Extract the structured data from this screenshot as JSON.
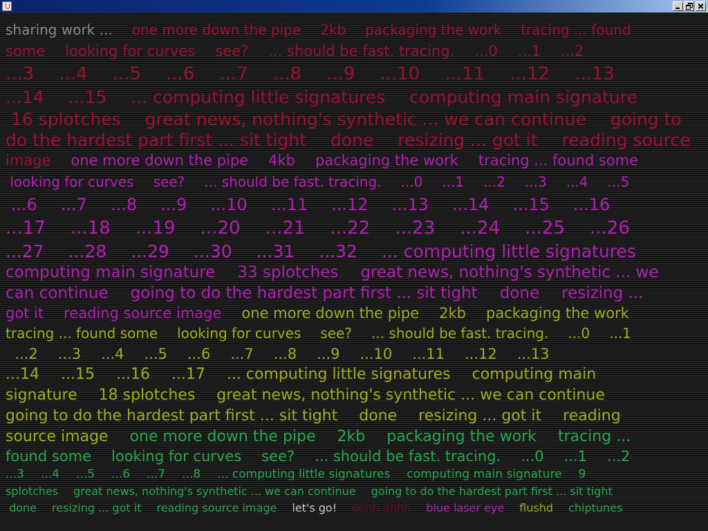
{
  "window": {
    "title": "",
    "buttons": {
      "minimize": "minimize",
      "maximize": "maximize",
      "close": "close"
    }
  },
  "colors": {
    "background": "#1c1c1c",
    "gray": "#8a8a8a",
    "red": "#9a1230",
    "magenta": "#b31fb5",
    "olive": "#a3ad21",
    "green": "#29a84e",
    "white": "#dddddd"
  },
  "lines": [
    {
      "size": 20,
      "h": 30,
      "segs": [
        {
          "t": "sharing work ...",
          "c": "#8a8a8a"
        },
        {
          "t": "one more down the pipe",
          "c": "#9a1230"
        },
        {
          "t": "2kb",
          "c": "#9a1230"
        },
        {
          "t": "packaging the work",
          "c": "#9a1230"
        },
        {
          "t": "tracing ... found",
          "c": "#9a1230"
        }
      ]
    },
    {
      "size": 21,
      "h": 32,
      "segs": [
        {
          "t": "some",
          "c": "#9a1230"
        },
        {
          "t": "looking for curves",
          "c": "#9a1230"
        },
        {
          "t": "see?",
          "c": "#9a1230"
        },
        {
          "t": "... should be fast. tracing.",
          "c": "#9a1230"
        },
        {
          "t": "...0",
          "c": "#9a1230"
        },
        {
          "t": "...1",
          "c": "#9a1230"
        },
        {
          "t": "...2",
          "c": "#9a1230"
        }
      ]
    },
    {
      "size": 26,
      "h": 34,
      "segs": [
        {
          "t": "...3",
          "c": "#9a1230"
        },
        {
          "t": "...4",
          "c": "#9a1230"
        },
        {
          "t": "...5",
          "c": "#9a1230"
        },
        {
          "t": "...6",
          "c": "#9a1230"
        },
        {
          "t": "...7",
          "c": "#9a1230"
        },
        {
          "t": "...8",
          "c": "#9a1230"
        },
        {
          "t": "...9",
          "c": "#9a1230"
        },
        {
          "t": "...10",
          "c": "#9a1230"
        },
        {
          "t": "...11",
          "c": "#9a1230"
        },
        {
          "t": "...12",
          "c": "#9a1230"
        },
        {
          "t": "...13",
          "c": "#9a1230"
        }
      ]
    },
    {
      "size": 25,
      "h": 33,
      "segs": [
        {
          "t": "...14",
          "c": "#9a1230"
        },
        {
          "t": "...15",
          "c": "#9a1230"
        },
        {
          "t": "... computing little signatures",
          "c": "#9a1230"
        },
        {
          "t": "computing main signature",
          "c": "#9a1230"
        }
      ]
    },
    {
      "size": 25,
      "h": 31,
      "segs": [
        {
          "t": " 16 splotches",
          "c": "#9a1230"
        },
        {
          "t": "great news, nothing's synthetic ... we can continue",
          "c": "#9a1230"
        },
        {
          "t": "going to",
          "c": "#9a1230"
        }
      ]
    },
    {
      "size": 25,
      "h": 30,
      "segs": [
        {
          "t": "do the hardest part first ... sit tight",
          "c": "#9a1230"
        },
        {
          "t": "done",
          "c": "#9a1230"
        },
        {
          "t": "resizing ... got it",
          "c": "#9a1230"
        },
        {
          "t": "reading source",
          "c": "#9a1230"
        }
      ]
    },
    {
      "size": 21,
      "h": 29,
      "segs": [
        {
          "t": "image",
          "c": "#9a1230"
        },
        {
          "t": "one more down the pipe",
          "c": "#b31fb5"
        },
        {
          "t": "4kb",
          "c": "#b31fb5"
        },
        {
          "t": "packaging the work",
          "c": "#b31fb5"
        },
        {
          "t": "tracing ... found some",
          "c": "#b31fb5"
        }
      ]
    },
    {
      "size": 20,
      "h": 32,
      "segs": [
        {
          "t": " looking for curves",
          "c": "#b31fb5"
        },
        {
          "t": "see?",
          "c": "#b31fb5"
        },
        {
          "t": "... should be fast. tracing.",
          "c": "#b31fb5"
        },
        {
          "t": "...0",
          "c": "#b31fb5"
        },
        {
          "t": "...1",
          "c": "#b31fb5"
        },
        {
          "t": "...2",
          "c": "#b31fb5"
        },
        {
          "t": "...3",
          "c": "#b31fb5"
        },
        {
          "t": "...4",
          "c": "#b31fb5"
        },
        {
          "t": "...5",
          "c": "#b31fb5"
        }
      ]
    },
    {
      "size": 24,
      "h": 34,
      "segs": [
        {
          "t": " ...6",
          "c": "#b31fb5"
        },
        {
          "t": "...7",
          "c": "#b31fb5"
        },
        {
          "t": "...8",
          "c": "#b31fb5"
        },
        {
          "t": "...9",
          "c": "#b31fb5"
        },
        {
          "t": "...10",
          "c": "#b31fb5"
        },
        {
          "t": "...11",
          "c": "#b31fb5"
        },
        {
          "t": "...12",
          "c": "#b31fb5"
        },
        {
          "t": "...13",
          "c": "#b31fb5"
        },
        {
          "t": "...14",
          "c": "#b31fb5"
        },
        {
          "t": "...15",
          "c": "#b31fb5"
        },
        {
          "t": "...16",
          "c": "#b31fb5"
        }
      ]
    },
    {
      "size": 26,
      "h": 35,
      "segs": [
        {
          "t": "...17",
          "c": "#b31fb5"
        },
        {
          "t": "...18",
          "c": "#b31fb5"
        },
        {
          "t": "...19",
          "c": "#b31fb5"
        },
        {
          "t": "...20",
          "c": "#b31fb5"
        },
        {
          "t": "...21",
          "c": "#b31fb5"
        },
        {
          "t": "...22",
          "c": "#b31fb5"
        },
        {
          "t": "...23",
          "c": "#b31fb5"
        },
        {
          "t": "...24",
          "c": "#b31fb5"
        },
        {
          "t": "...25",
          "c": "#b31fb5"
        },
        {
          "t": "...26",
          "c": "#b31fb5"
        }
      ]
    },
    {
      "size": 25,
      "h": 31,
      "segs": [
        {
          "t": "...27",
          "c": "#b31fb5"
        },
        {
          "t": "...28",
          "c": "#b31fb5"
        },
        {
          "t": "...29",
          "c": "#b31fb5"
        },
        {
          "t": "...30",
          "c": "#b31fb5"
        },
        {
          "t": "...31",
          "c": "#b31fb5"
        },
        {
          "t": "...32",
          "c": "#b31fb5"
        },
        {
          "t": "... computing little signatures",
          "c": "#b31fb5"
        }
      ]
    },
    {
      "size": 23,
      "h": 30,
      "segs": [
        {
          "t": "computing main signature",
          "c": "#b31fb5"
        },
        {
          "t": "33 splotches",
          "c": "#b31fb5"
        },
        {
          "t": "great news, nothing's synthetic ... we",
          "c": "#b31fb5"
        }
      ]
    },
    {
      "size": 23,
      "h": 30,
      "segs": [
        {
          "t": "can continue",
          "c": "#b31fb5"
        },
        {
          "t": "going to do the hardest part first ... sit tight",
          "c": "#b31fb5"
        },
        {
          "t": "done",
          "c": "#b31fb5"
        },
        {
          "t": "resizing ...",
          "c": "#b31fb5"
        }
      ]
    },
    {
      "size": 21,
      "h": 29,
      "segs": [
        {
          "t": "got it",
          "c": "#b31fb5"
        },
        {
          "t": "reading source image",
          "c": "#b31fb5"
        },
        {
          "t": "one more down the pipe",
          "c": "#a3ad21"
        },
        {
          "t": "2kb",
          "c": "#a3ad21"
        },
        {
          "t": "packaging the work",
          "c": "#a3ad21"
        }
      ]
    },
    {
      "size": 20,
      "h": 29,
      "segs": [
        {
          "t": "tracing ... found some",
          "c": "#a3ad21"
        },
        {
          "t": "looking for curves",
          "c": "#a3ad21"
        },
        {
          "t": "see?",
          "c": "#a3ad21"
        },
        {
          "t": "... should be fast. tracing.",
          "c": "#a3ad21"
        },
        {
          "t": "...0",
          "c": "#a3ad21"
        },
        {
          "t": "...1",
          "c": "#a3ad21"
        }
      ]
    },
    {
      "size": 21,
      "h": 30,
      "segs": [
        {
          "t": "  ...2",
          "c": "#a3ad21"
        },
        {
          "t": "...3",
          "c": "#a3ad21"
        },
        {
          "t": "...4",
          "c": "#a3ad21"
        },
        {
          "t": "...5",
          "c": "#a3ad21"
        },
        {
          "t": "...6",
          "c": "#a3ad21"
        },
        {
          "t": "...7",
          "c": "#a3ad21"
        },
        {
          "t": "...8",
          "c": "#a3ad21"
        },
        {
          "t": "...9",
          "c": "#a3ad21"
        },
        {
          "t": "...10",
          "c": "#a3ad21"
        },
        {
          "t": "...11",
          "c": "#a3ad21"
        },
        {
          "t": "...12",
          "c": "#a3ad21"
        },
        {
          "t": "...13",
          "c": "#a3ad21"
        }
      ]
    },
    {
      "size": 22,
      "h": 30,
      "segs": [
        {
          "t": "...14",
          "c": "#a3ad21"
        },
        {
          "t": "...15",
          "c": "#a3ad21"
        },
        {
          "t": "...16",
          "c": "#a3ad21"
        },
        {
          "t": "...17",
          "c": "#a3ad21"
        },
        {
          "t": "... computing little signatures",
          "c": "#a3ad21"
        },
        {
          "t": "computing main",
          "c": "#a3ad21"
        }
      ]
    },
    {
      "size": 22,
      "h": 30,
      "segs": [
        {
          "t": "signature",
          "c": "#a3ad21"
        },
        {
          "t": "18 splotches",
          "c": "#a3ad21"
        },
        {
          "t": "great news, nothing's synthetic ... we can continue",
          "c": "#a3ad21"
        }
      ]
    },
    {
      "size": 22,
      "h": 30,
      "segs": [
        {
          "t": "going to do the hardest part first ... sit tight",
          "c": "#a3ad21"
        },
        {
          "t": "done",
          "c": "#a3ad21"
        },
        {
          "t": "resizing ... got it",
          "c": "#a3ad21"
        },
        {
          "t": "reading",
          "c": "#a3ad21"
        }
      ]
    },
    {
      "size": 22,
      "h": 29,
      "segs": [
        {
          "t": "source image",
          "c": "#a3ad21"
        },
        {
          "t": "one more down the pipe",
          "c": "#29a84e"
        },
        {
          "t": "2kb",
          "c": "#29a84e"
        },
        {
          "t": "packaging the work",
          "c": "#29a84e"
        },
        {
          "t": "tracing ...",
          "c": "#29a84e"
        }
      ]
    },
    {
      "size": 21,
      "h": 28,
      "segs": [
        {
          "t": "found some",
          "c": "#29a84e"
        },
        {
          "t": "looking for curves",
          "c": "#29a84e"
        },
        {
          "t": "see?",
          "c": "#29a84e"
        },
        {
          "t": "... should be fast. tracing.",
          "c": "#29a84e"
        },
        {
          "t": "...0",
          "c": "#29a84e"
        },
        {
          "t": "...1",
          "c": "#29a84e"
        },
        {
          "t": "...2",
          "c": "#29a84e"
        }
      ]
    },
    {
      "size": 17,
      "h": 25,
      "segs": [
        {
          "t": "...3",
          "c": "#29a84e"
        },
        {
          "t": "...4",
          "c": "#29a84e"
        },
        {
          "t": "...5",
          "c": "#29a84e"
        },
        {
          "t": "...6",
          "c": "#29a84e"
        },
        {
          "t": "...7",
          "c": "#29a84e"
        },
        {
          "t": "...8",
          "c": "#29a84e"
        },
        {
          "t": "... computing little signatures",
          "c": "#29a84e"
        },
        {
          "t": "computing main signature",
          "c": "#29a84e"
        },
        {
          "t": "9",
          "c": "#29a84e"
        }
      ]
    },
    {
      "size": 16,
      "h": 24,
      "segs": [
        {
          "t": "splotches",
          "c": "#29a84e"
        },
        {
          "t": "great news, nothing's synthetic ... we can continue",
          "c": "#29a84e"
        },
        {
          "t": "going to do the hardest part first ... sit tight",
          "c": "#29a84e"
        }
      ]
    },
    {
      "size": 16,
      "h": 24,
      "segs": [
        {
          "t": " done",
          "c": "#29a84e"
        },
        {
          "t": "resizing ... got it",
          "c": "#29a84e"
        },
        {
          "t": "reading source image",
          "c": "#29a84e"
        },
        {
          "t": "let's go!",
          "c": "#c9c9c9"
        },
        {
          "t": "oohh ahhh",
          "c": "#6a0f22"
        },
        {
          "t": "blue laser eye",
          "c": "#b31fb5"
        },
        {
          "t": "flushd",
          "c": "#a3ad21"
        },
        {
          "t": "chiptunes",
          "c": "#29a84e"
        }
      ]
    }
  ]
}
